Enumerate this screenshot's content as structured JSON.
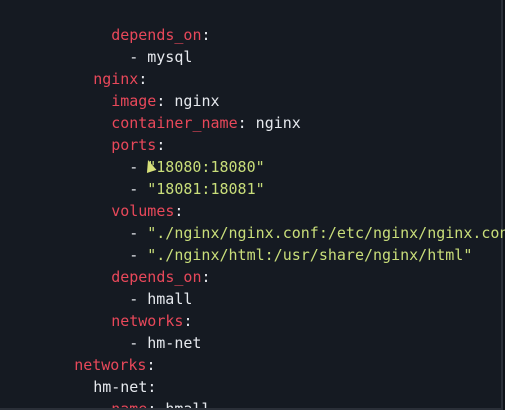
{
  "lines": [
    {
      "indent": 4,
      "key": "depends_on",
      "sep": ":",
      "value": ""
    },
    {
      "indent": 6,
      "dash": "- ",
      "value": "mysql"
    },
    {
      "indent": 2,
      "key": "nginx",
      "sep": ":",
      "value": ""
    },
    {
      "indent": 4,
      "key": "image",
      "sep": ":",
      "value": " nginx"
    },
    {
      "indent": 4,
      "key": "container_name",
      "sep": ":",
      "value": " nginx"
    },
    {
      "indent": 4,
      "key": "ports",
      "sep": ":",
      "value": ""
    },
    {
      "indent": 6,
      "dash": "- ",
      "str": "\"18080:18080\""
    },
    {
      "indent": 6,
      "dash": "- ",
      "str": "\"18081:18081\""
    },
    {
      "indent": 4,
      "key": "volumes",
      "sep": ":",
      "value": ""
    },
    {
      "indent": 6,
      "dash": "- ",
      "str": "\"./nginx/nginx.conf:/etc/nginx/nginx.conf\""
    },
    {
      "indent": 6,
      "dash": "- ",
      "str": "\"./nginx/html:/usr/share/nginx/html\""
    },
    {
      "indent": 4,
      "key": "depends_on",
      "sep": ":",
      "value": ""
    },
    {
      "indent": 6,
      "dash": "- ",
      "value": "hmall"
    },
    {
      "indent": 4,
      "key": "networks",
      "sep": ":",
      "value": ""
    },
    {
      "indent": 6,
      "dash": "- ",
      "value": "hm-net"
    },
    {
      "indent": 0,
      "key": "networks",
      "sep": ":",
      "value": ""
    },
    {
      "indent": 2,
      "plainkey": "hm-net",
      "sep": ":",
      "value": ""
    },
    {
      "indent": 4,
      "key": "name",
      "sep": ":",
      "value": " hmall"
    }
  ],
  "colors": {
    "background": "#151a22",
    "key": "#e8485a",
    "string": "#c9de7a",
    "text": "#e6e9ee"
  }
}
